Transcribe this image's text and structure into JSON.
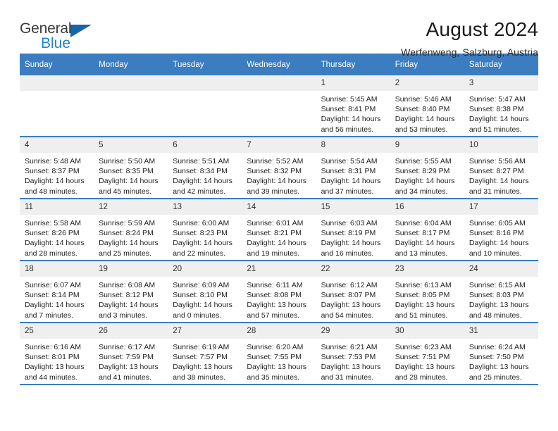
{
  "brand": {
    "line1": "General",
    "line2": "Blue",
    "triangle_color": "#1565a8",
    "blue_text_color": "#1f84cf"
  },
  "header": {
    "title": "August 2024",
    "subtitle": "Werfenweng, Salzburg, Austria"
  },
  "theme": {
    "header_blue": "#3b7dc0",
    "daynum_band": "#efefef",
    "text": "#222222"
  },
  "weekday_headers": [
    "Sunday",
    "Monday",
    "Tuesday",
    "Wednesday",
    "Thursday",
    "Friday",
    "Saturday"
  ],
  "weeks": [
    [
      {
        "day": "",
        "lines": []
      },
      {
        "day": "",
        "lines": []
      },
      {
        "day": "",
        "lines": []
      },
      {
        "day": "",
        "lines": []
      },
      {
        "day": "1",
        "lines": [
          "Sunrise: 5:45 AM",
          "Sunset: 8:41 PM",
          "Daylight: 14 hours",
          "and 56 minutes."
        ]
      },
      {
        "day": "2",
        "lines": [
          "Sunrise: 5:46 AM",
          "Sunset: 8:40 PM",
          "Daylight: 14 hours",
          "and 53 minutes."
        ]
      },
      {
        "day": "3",
        "lines": [
          "Sunrise: 5:47 AM",
          "Sunset: 8:38 PM",
          "Daylight: 14 hours",
          "and 51 minutes."
        ]
      }
    ],
    [
      {
        "day": "4",
        "lines": [
          "Sunrise: 5:48 AM",
          "Sunset: 8:37 PM",
          "Daylight: 14 hours",
          "and 48 minutes."
        ]
      },
      {
        "day": "5",
        "lines": [
          "Sunrise: 5:50 AM",
          "Sunset: 8:35 PM",
          "Daylight: 14 hours",
          "and 45 minutes."
        ]
      },
      {
        "day": "6",
        "lines": [
          "Sunrise: 5:51 AM",
          "Sunset: 8:34 PM",
          "Daylight: 14 hours",
          "and 42 minutes."
        ]
      },
      {
        "day": "7",
        "lines": [
          "Sunrise: 5:52 AM",
          "Sunset: 8:32 PM",
          "Daylight: 14 hours",
          "and 39 minutes."
        ]
      },
      {
        "day": "8",
        "lines": [
          "Sunrise: 5:54 AM",
          "Sunset: 8:31 PM",
          "Daylight: 14 hours",
          "and 37 minutes."
        ]
      },
      {
        "day": "9",
        "lines": [
          "Sunrise: 5:55 AM",
          "Sunset: 8:29 PM",
          "Daylight: 14 hours",
          "and 34 minutes."
        ]
      },
      {
        "day": "10",
        "lines": [
          "Sunrise: 5:56 AM",
          "Sunset: 8:27 PM",
          "Daylight: 14 hours",
          "and 31 minutes."
        ]
      }
    ],
    [
      {
        "day": "11",
        "lines": [
          "Sunrise: 5:58 AM",
          "Sunset: 8:26 PM",
          "Daylight: 14 hours",
          "and 28 minutes."
        ]
      },
      {
        "day": "12",
        "lines": [
          "Sunrise: 5:59 AM",
          "Sunset: 8:24 PM",
          "Daylight: 14 hours",
          "and 25 minutes."
        ]
      },
      {
        "day": "13",
        "lines": [
          "Sunrise: 6:00 AM",
          "Sunset: 8:23 PM",
          "Daylight: 14 hours",
          "and 22 minutes."
        ]
      },
      {
        "day": "14",
        "lines": [
          "Sunrise: 6:01 AM",
          "Sunset: 8:21 PM",
          "Daylight: 14 hours",
          "and 19 minutes."
        ]
      },
      {
        "day": "15",
        "lines": [
          "Sunrise: 6:03 AM",
          "Sunset: 8:19 PM",
          "Daylight: 14 hours",
          "and 16 minutes."
        ]
      },
      {
        "day": "16",
        "lines": [
          "Sunrise: 6:04 AM",
          "Sunset: 8:17 PM",
          "Daylight: 14 hours",
          "and 13 minutes."
        ]
      },
      {
        "day": "17",
        "lines": [
          "Sunrise: 6:05 AM",
          "Sunset: 8:16 PM",
          "Daylight: 14 hours",
          "and 10 minutes."
        ]
      }
    ],
    [
      {
        "day": "18",
        "lines": [
          "Sunrise: 6:07 AM",
          "Sunset: 8:14 PM",
          "Daylight: 14 hours",
          "and 7 minutes."
        ]
      },
      {
        "day": "19",
        "lines": [
          "Sunrise: 6:08 AM",
          "Sunset: 8:12 PM",
          "Daylight: 14 hours",
          "and 3 minutes."
        ]
      },
      {
        "day": "20",
        "lines": [
          "Sunrise: 6:09 AM",
          "Sunset: 8:10 PM",
          "Daylight: 14 hours",
          "and 0 minutes."
        ]
      },
      {
        "day": "21",
        "lines": [
          "Sunrise: 6:11 AM",
          "Sunset: 8:08 PM",
          "Daylight: 13 hours",
          "and 57 minutes."
        ]
      },
      {
        "day": "22",
        "lines": [
          "Sunrise: 6:12 AM",
          "Sunset: 8:07 PM",
          "Daylight: 13 hours",
          "and 54 minutes."
        ]
      },
      {
        "day": "23",
        "lines": [
          "Sunrise: 6:13 AM",
          "Sunset: 8:05 PM",
          "Daylight: 13 hours",
          "and 51 minutes."
        ]
      },
      {
        "day": "24",
        "lines": [
          "Sunrise: 6:15 AM",
          "Sunset: 8:03 PM",
          "Daylight: 13 hours",
          "and 48 minutes."
        ]
      }
    ],
    [
      {
        "day": "25",
        "lines": [
          "Sunrise: 6:16 AM",
          "Sunset: 8:01 PM",
          "Daylight: 13 hours",
          "and 44 minutes."
        ]
      },
      {
        "day": "26",
        "lines": [
          "Sunrise: 6:17 AM",
          "Sunset: 7:59 PM",
          "Daylight: 13 hours",
          "and 41 minutes."
        ]
      },
      {
        "day": "27",
        "lines": [
          "Sunrise: 6:19 AM",
          "Sunset: 7:57 PM",
          "Daylight: 13 hours",
          "and 38 minutes."
        ]
      },
      {
        "day": "28",
        "lines": [
          "Sunrise: 6:20 AM",
          "Sunset: 7:55 PM",
          "Daylight: 13 hours",
          "and 35 minutes."
        ]
      },
      {
        "day": "29",
        "lines": [
          "Sunrise: 6:21 AM",
          "Sunset: 7:53 PM",
          "Daylight: 13 hours",
          "and 31 minutes."
        ]
      },
      {
        "day": "30",
        "lines": [
          "Sunrise: 6:23 AM",
          "Sunset: 7:51 PM",
          "Daylight: 13 hours",
          "and 28 minutes."
        ]
      },
      {
        "day": "31",
        "lines": [
          "Sunrise: 6:24 AM",
          "Sunset: 7:50 PM",
          "Daylight: 13 hours",
          "and 25 minutes."
        ]
      }
    ]
  ]
}
